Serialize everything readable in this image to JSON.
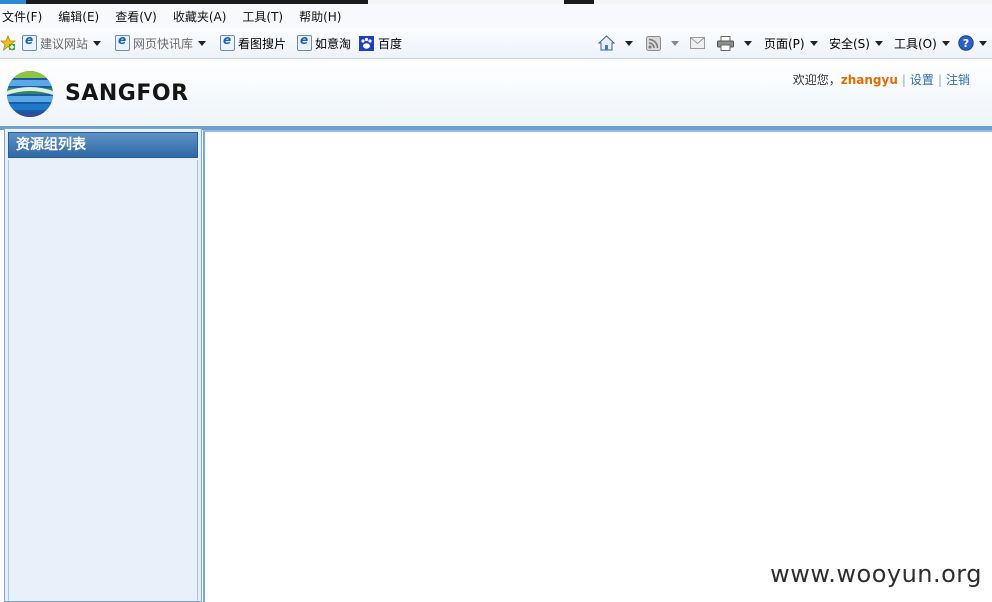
{
  "menu": [
    "文件(F)",
    "编辑(E)",
    "查看(V)",
    "收藏夹(A)",
    "工具(T)",
    "帮助(H)"
  ],
  "favorites": [
    {
      "label": "建议网站",
      "icon": "ie-page-icon",
      "dim": true,
      "dropdown": true
    },
    {
      "label": "网页快讯库",
      "icon": "ie-page-icon",
      "dim": true,
      "dropdown": true
    },
    {
      "label": "看图搜片",
      "icon": "ie-page-icon",
      "dim": false,
      "dropdown": false
    },
    {
      "label": "如意淘",
      "icon": "ie-page-icon",
      "dim": false,
      "dropdown": false
    },
    {
      "label": "百度",
      "icon": "baidu-paw-icon",
      "dim": false,
      "dropdown": false
    }
  ],
  "command_bar": {
    "page": "页面(P)",
    "safety": "安全(S)",
    "tools": "工具(O)"
  },
  "header": {
    "brand": "SANGFOR",
    "welcome": "欢迎您，",
    "username": "zhangyu",
    "settings": "设置",
    "logout": "注销"
  },
  "sidebar": {
    "title": "资源组列表",
    "items": []
  },
  "watermark": "www.wooyun.org",
  "colors": {
    "accent_blue": "#2e69a6",
    "username_orange": "#e66a00",
    "panel_bg": "#e6eef8"
  }
}
